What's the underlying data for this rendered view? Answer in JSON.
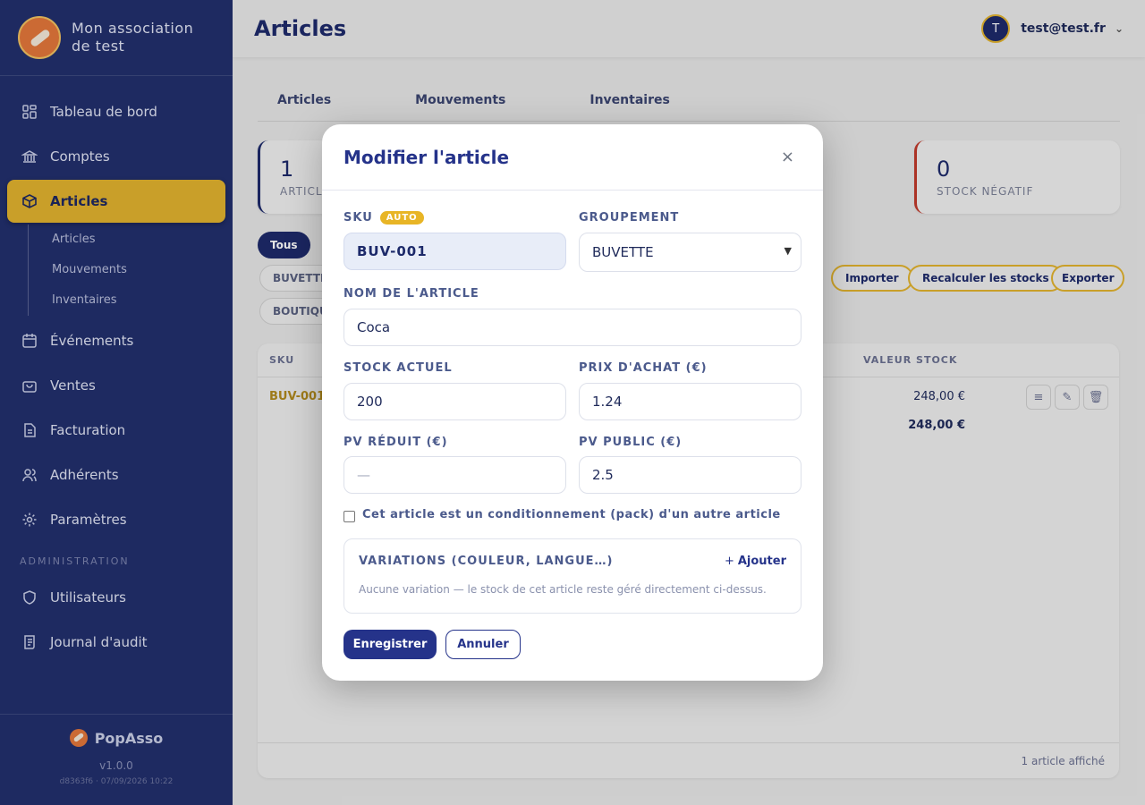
{
  "sidebar": {
    "org_name": "Mon association de test",
    "nav": [
      {
        "label": "Tableau de bord",
        "icon": "dashboard-icon"
      },
      {
        "label": "Comptes",
        "icon": "bank-icon"
      },
      {
        "label": "Articles",
        "icon": "box-icon",
        "active": true
      },
      {
        "label": "Événements",
        "icon": "calendar-icon"
      },
      {
        "label": "Ventes",
        "icon": "bag-icon"
      },
      {
        "label": "Facturation",
        "icon": "invoice-icon"
      },
      {
        "label": "Adhérents",
        "icon": "users-icon"
      },
      {
        "label": "Paramètres",
        "icon": "gear-icon"
      }
    ],
    "subnav": [
      "Articles",
      "Mouvements",
      "Inventaires"
    ],
    "admin_label": "ADMINISTRATION",
    "admin_nav": [
      {
        "label": "Utilisateurs",
        "icon": "shield-icon"
      },
      {
        "label": "Journal d'audit",
        "icon": "scroll-icon"
      }
    ],
    "footer": {
      "brand": "PopAsso",
      "version": "v1.0.0",
      "build": "d8363f6 · 07/09/2026 10:22"
    }
  },
  "header": {
    "title": "Articles",
    "user_initial": "T",
    "user_email": "test@test.fr"
  },
  "tabs": [
    "Articles",
    "Mouvements",
    "Inventaires"
  ],
  "stats": [
    {
      "value": "1",
      "label": "ARTICLES"
    },
    {
      "value": "0",
      "label": "STOCK NÉGATIF"
    }
  ],
  "filters": {
    "all": "Tous",
    "groups": [
      "BUVETTE",
      "BOUTIQUE"
    ],
    "actions": [
      "Importer",
      "Recalculer les stocks",
      "Exporter"
    ]
  },
  "table": {
    "headers": {
      "sku": "SKU",
      "value": "VALEUR STOCK"
    },
    "rows": [
      {
        "sku": "BUV-001",
        "value": "248,00 €"
      }
    ],
    "total": "248,00 €",
    "footer": "1 article affiché"
  },
  "modal": {
    "title": "Modifier l'article",
    "close": "×",
    "sku_label": "SKU",
    "auto_badge": "AUTO",
    "sku_value": "BUV-001",
    "group_label": "GROUPEMENT",
    "group_value": "BUVETTE",
    "name_label": "NOM DE L'ARTICLE",
    "name_value": "Coca",
    "stock_label": "STOCK ACTUEL",
    "stock_value": "200",
    "purchase_label": "PRIX D'ACHAT (€)",
    "purchase_value": "1.24",
    "reduced_label": "PV RÉDUIT (€)",
    "reduced_placeholder": "—",
    "public_label": "PV PUBLIC (€)",
    "public_value": "2.5",
    "pack_label": "Cet article est un conditionnement (pack) d'un autre article",
    "variations_title": "VARIATIONS (COULEUR, LANGUE…)",
    "variations_add": "Ajouter",
    "variations_empty": "Aucune variation — le stock de cet article reste géré directement ci-dessus.",
    "save": "Enregistrer",
    "cancel": "Annuler"
  }
}
